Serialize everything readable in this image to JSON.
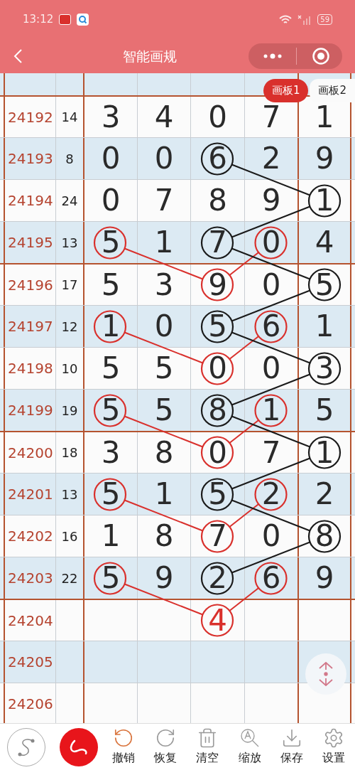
{
  "status_bar": {
    "time": "13:12",
    "battery": "59"
  },
  "nav": {
    "title": "智能画规"
  },
  "board_tabs": [
    {
      "label": "画板1",
      "selected": true
    },
    {
      "label": "画板2",
      "selected": false
    }
  ],
  "rows": [
    {
      "shaded": true,
      "group_start": false
    },
    {
      "issue": "24192",
      "sum": "14",
      "shaded": false,
      "group_start": true,
      "cells": [
        {
          "value": "3"
        },
        {
          "value": "4"
        },
        {
          "value": "0"
        },
        {
          "value": "7"
        },
        {
          "value": "1"
        }
      ]
    },
    {
      "issue": "24193",
      "sum": "8",
      "shaded": true,
      "group_start": false,
      "cells": [
        {
          "value": "0"
        },
        {
          "value": "0"
        },
        {
          "value": "6",
          "color": "#1a1a1a",
          "linked_up": false,
          "predicted": false
        },
        {
          "value": "2"
        },
        {
          "value": "9"
        }
      ]
    },
    {
      "issue": "24194",
      "sum": "24",
      "shaded": false,
      "group_start": false,
      "cells": [
        {
          "value": "0"
        },
        {
          "value": "7"
        },
        {
          "value": "8"
        },
        {
          "value": "9"
        },
        {
          "value": "1",
          "color": "#1a1a1a",
          "linked_up": true,
          "predicted": false
        }
      ]
    },
    {
      "issue": "24195",
      "sum": "13",
      "shaded": true,
      "group_start": false,
      "cells": [
        {
          "value": "5",
          "color": "#d9302c",
          "linked_up": false,
          "predicted": false
        },
        {
          "value": "1"
        },
        {
          "value": "7",
          "color": "#1a1a1a",
          "linked_up": true,
          "predicted": false
        },
        {
          "value": "0",
          "color": "#d9302c",
          "linked_up": false,
          "predicted": false
        },
        {
          "value": "4"
        }
      ]
    },
    {
      "issue": "24196",
      "sum": "17",
      "shaded": false,
      "group_start": true,
      "cells": [
        {
          "value": "5"
        },
        {
          "value": "3"
        },
        {
          "value": "9",
          "color": "#d9302c",
          "linked_up": true,
          "predicted": false
        },
        {
          "value": "0"
        },
        {
          "value": "5",
          "color": "#1a1a1a",
          "linked_up": true,
          "predicted": false
        }
      ]
    },
    {
      "issue": "24197",
      "sum": "12",
      "shaded": true,
      "group_start": false,
      "cells": [
        {
          "value": "1",
          "color": "#d9302c",
          "linked_up": false,
          "predicted": false
        },
        {
          "value": "0"
        },
        {
          "value": "5",
          "color": "#1a1a1a",
          "linked_up": true,
          "predicted": false
        },
        {
          "value": "6",
          "color": "#d9302c",
          "linked_up": false,
          "predicted": false
        },
        {
          "value": "1"
        }
      ]
    },
    {
      "issue": "24198",
      "sum": "10",
      "shaded": false,
      "group_start": false,
      "cells": [
        {
          "value": "5"
        },
        {
          "value": "5"
        },
        {
          "value": "0",
          "color": "#d9302c",
          "linked_up": true,
          "predicted": false
        },
        {
          "value": "0"
        },
        {
          "value": "3",
          "color": "#1a1a1a",
          "linked_up": true,
          "predicted": false
        }
      ]
    },
    {
      "issue": "24199",
      "sum": "19",
      "shaded": true,
      "group_start": false,
      "cells": [
        {
          "value": "5",
          "color": "#d9302c",
          "linked_up": false,
          "predicted": false
        },
        {
          "value": "5"
        },
        {
          "value": "8",
          "color": "#1a1a1a",
          "linked_up": true,
          "predicted": false
        },
        {
          "value": "1",
          "color": "#d9302c",
          "linked_up": false,
          "predicted": false
        },
        {
          "value": "5"
        }
      ]
    },
    {
      "issue": "24200",
      "sum": "18",
      "shaded": false,
      "group_start": true,
      "cells": [
        {
          "value": "3"
        },
        {
          "value": "8"
        },
        {
          "value": "0",
          "color": "#d9302c",
          "linked_up": true,
          "predicted": false
        },
        {
          "value": "7"
        },
        {
          "value": "1",
          "color": "#1a1a1a",
          "linked_up": true,
          "predicted": false
        }
      ]
    },
    {
      "issue": "24201",
      "sum": "13",
      "shaded": true,
      "group_start": false,
      "cells": [
        {
          "value": "5",
          "color": "#d9302c",
          "linked_up": false,
          "predicted": false
        },
        {
          "value": "1"
        },
        {
          "value": "5",
          "color": "#1a1a1a",
          "linked_up": true,
          "predicted": false
        },
        {
          "value": "2",
          "color": "#d9302c",
          "linked_up": false,
          "predicted": false
        },
        {
          "value": "2"
        }
      ]
    },
    {
      "issue": "24202",
      "sum": "16",
      "shaded": false,
      "group_start": false,
      "cells": [
        {
          "value": "1"
        },
        {
          "value": "8"
        },
        {
          "value": "7",
          "color": "#d9302c",
          "linked_up": true,
          "predicted": false
        },
        {
          "value": "0"
        },
        {
          "value": "8",
          "color": "#1a1a1a",
          "linked_up": true,
          "predicted": false
        }
      ]
    },
    {
      "issue": "24203",
      "sum": "22",
      "shaded": true,
      "group_start": false,
      "cells": [
        {
          "value": "5",
          "color": "#d9302c",
          "linked_up": false,
          "predicted": false
        },
        {
          "value": "9"
        },
        {
          "value": "2",
          "color": "#1a1a1a",
          "linked_up": true,
          "predicted": false
        },
        {
          "value": "6",
          "color": "#d9302c",
          "linked_up": false,
          "predicted": false
        },
        {
          "value": "9"
        }
      ]
    },
    {
      "issue": "24204",
      "shaded": false,
      "group_start": true,
      "cells": [
        {},
        {},
        {
          "value": "4",
          "color": "#d9302c",
          "linked_up": true,
          "predicted": true
        },
        {},
        {}
      ]
    },
    {
      "issue": "24205",
      "shaded": true,
      "group_start": false
    },
    {
      "issue": "24206",
      "shaded": false,
      "group_start": false
    }
  ],
  "modes": [
    {
      "kind": "curve",
      "selected": false
    },
    {
      "kind": "freehand",
      "selected": true
    }
  ],
  "tools": [
    {
      "kind": "undo",
      "label": "撤销",
      "active": true
    },
    {
      "kind": "redo",
      "label": "恢复",
      "active": false
    },
    {
      "kind": "clear",
      "label": "清空",
      "active": false
    },
    {
      "kind": "zoom",
      "label": "缩放",
      "active": false
    },
    {
      "kind": "save",
      "label": "保存",
      "active": false
    },
    {
      "kind": "settings",
      "label": "设置",
      "active": false
    }
  ]
}
